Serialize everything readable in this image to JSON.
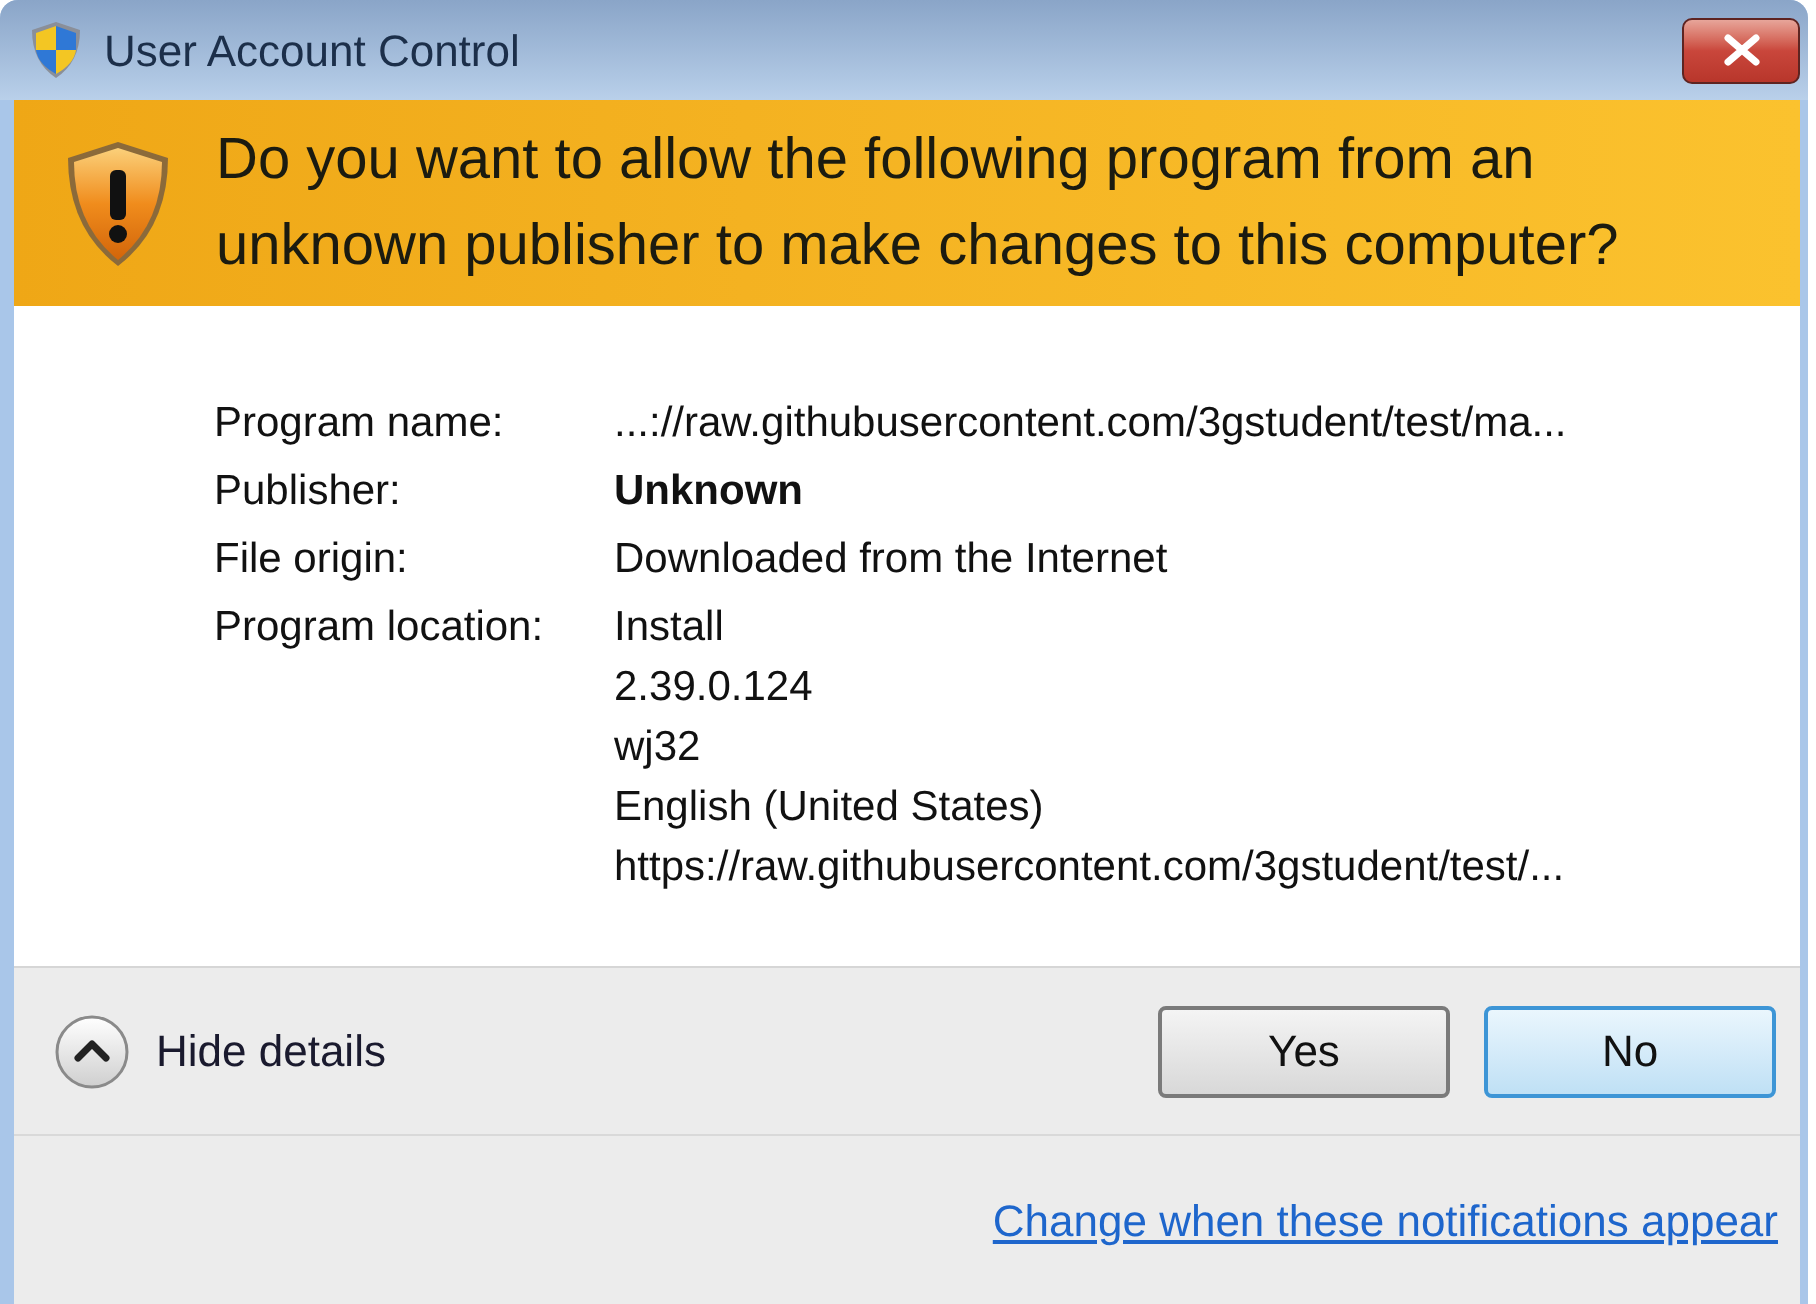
{
  "window": {
    "title": "User Account Control"
  },
  "banner": {
    "question": "Do you want to allow the following program from an unknown publisher to make changes to this computer?"
  },
  "details": [
    {
      "label": "Program name:",
      "values": [
        "...://raw.githubusercontent.com/3gstudent/test/ma..."
      ],
      "bold": false
    },
    {
      "label": "Publisher:",
      "values": [
        "Unknown"
      ],
      "bold": true
    },
    {
      "label": "File origin:",
      "values": [
        "Downloaded from the Internet"
      ],
      "bold": false
    },
    {
      "label": "Program location:",
      "values": [
        "Install",
        "2.39.0.124",
        "wj32",
        "English (United States)",
        "https://raw.githubusercontent.com/3gstudent/test/..."
      ],
      "bold": false
    }
  ],
  "footer": {
    "expander": {
      "label": "Hide details",
      "expanded": true
    },
    "buttons": [
      {
        "label": "Yes",
        "default": false
      },
      {
        "label": "No",
        "default": true
      }
    ],
    "link": "Change when these notifications appear"
  }
}
